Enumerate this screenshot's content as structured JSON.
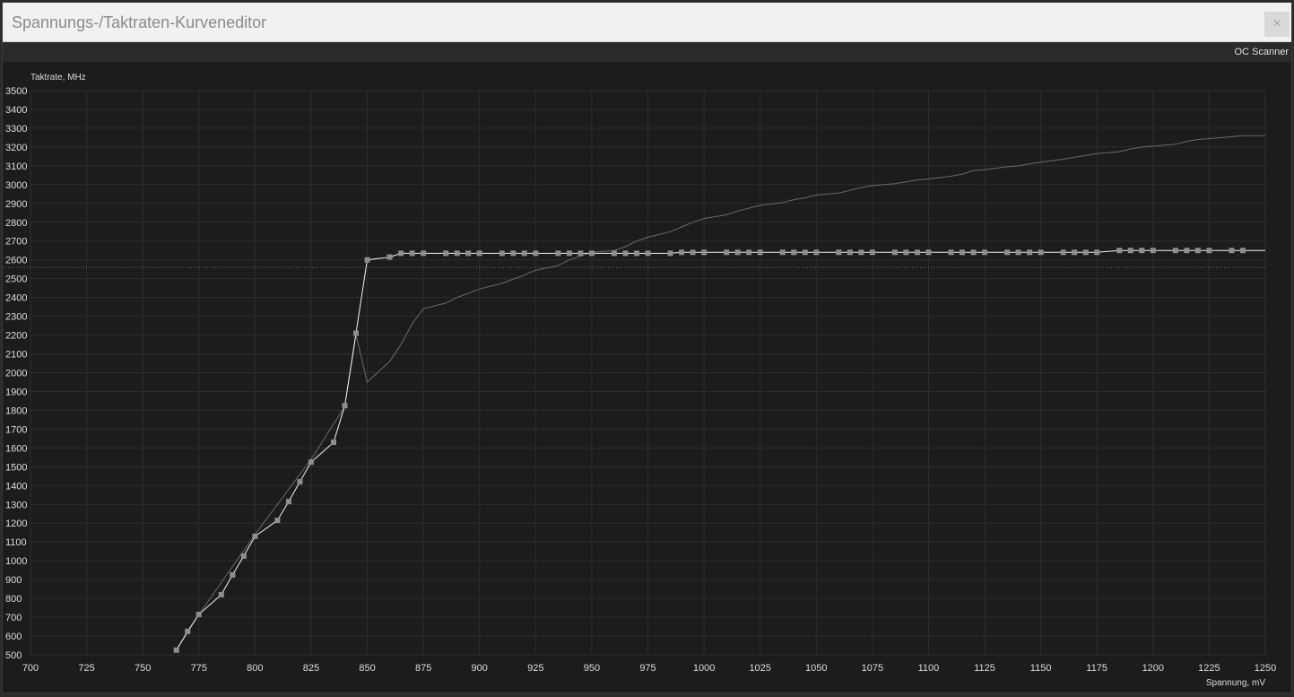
{
  "window": {
    "title": "Spannungs-/Taktraten-Kurveneditor",
    "close_symbol": "×"
  },
  "toolbar": {
    "oc_scanner_label": "OC Scanner"
  },
  "chart_data": {
    "type": "line",
    "title": "",
    "ylabel": "Taktrate, MHz",
    "xlabel": "Spannung, mV",
    "xlim": [
      700,
      1250
    ],
    "ylim": [
      500,
      3500
    ],
    "x_ticks": [
      700,
      725,
      750,
      775,
      800,
      825,
      850,
      875,
      900,
      925,
      950,
      975,
      1000,
      1025,
      1050,
      1075,
      1100,
      1125,
      1150,
      1175,
      1200,
      1225,
      1250
    ],
    "y_ticks": [
      500,
      600,
      700,
      800,
      900,
      1000,
      1100,
      1200,
      1300,
      1400,
      1500,
      1600,
      1700,
      1800,
      1900,
      2000,
      2100,
      2200,
      2300,
      2400,
      2500,
      2600,
      2700,
      2800,
      2900,
      3000,
      3100,
      3200,
      3300,
      3400,
      3500
    ],
    "grid": true,
    "reference_line_y": 2560,
    "colors": {
      "edit_curve": "#f2f2f2",
      "point": "#8e8e8e",
      "default_curve": "#6a6a6a",
      "grid": "#2e2e31",
      "axis_text": "#dcdcdc"
    },
    "series": [
      {
        "points": [
          [
            765,
            525
          ],
          [
            770,
            625
          ],
          [
            775,
            715
          ],
          [
            785,
            820
          ],
          [
            790,
            925
          ],
          [
            795,
            1025
          ],
          [
            800,
            1130
          ],
          [
            810,
            1215
          ],
          [
            815,
            1315
          ],
          [
            820,
            1420
          ],
          [
            825,
            1525
          ],
          [
            835,
            1630
          ],
          [
            840,
            1825
          ],
          [
            845,
            2210
          ],
          [
            850,
            2600
          ],
          [
            860,
            2615
          ],
          [
            865,
            2635
          ],
          [
            870,
            2635
          ],
          [
            875,
            2635
          ],
          [
            885,
            2635
          ],
          [
            890,
            2635
          ],
          [
            895,
            2635
          ],
          [
            900,
            2635
          ],
          [
            910,
            2635
          ],
          [
            915,
            2635
          ],
          [
            920,
            2635
          ],
          [
            925,
            2635
          ],
          [
            935,
            2635
          ],
          [
            940,
            2635
          ],
          [
            945,
            2635
          ],
          [
            950,
            2635
          ],
          [
            960,
            2635
          ],
          [
            965,
            2635
          ],
          [
            970,
            2635
          ],
          [
            975,
            2635
          ],
          [
            985,
            2635
          ],
          [
            990,
            2640
          ],
          [
            995,
            2640
          ],
          [
            1000,
            2640
          ],
          [
            1010,
            2640
          ],
          [
            1015,
            2640
          ],
          [
            1020,
            2640
          ],
          [
            1025,
            2640
          ],
          [
            1035,
            2640
          ],
          [
            1040,
            2640
          ],
          [
            1045,
            2640
          ],
          [
            1050,
            2640
          ],
          [
            1060,
            2640
          ],
          [
            1065,
            2640
          ],
          [
            1070,
            2640
          ],
          [
            1075,
            2640
          ],
          [
            1085,
            2640
          ],
          [
            1090,
            2640
          ],
          [
            1095,
            2640
          ],
          [
            1100,
            2640
          ],
          [
            1110,
            2640
          ],
          [
            1115,
            2640
          ],
          [
            1120,
            2640
          ],
          [
            1125,
            2640
          ],
          [
            1135,
            2640
          ],
          [
            1140,
            2640
          ],
          [
            1145,
            2640
          ],
          [
            1150,
            2640
          ],
          [
            1160,
            2640
          ],
          [
            1165,
            2640
          ],
          [
            1170,
            2640
          ],
          [
            1175,
            2640
          ],
          [
            1185,
            2650
          ],
          [
            1190,
            2650
          ],
          [
            1195,
            2650
          ],
          [
            1200,
            2650
          ],
          [
            1210,
            2650
          ],
          [
            1215,
            2650
          ],
          [
            1220,
            2650
          ],
          [
            1225,
            2650
          ],
          [
            1235,
            2650
          ],
          [
            1240,
            2650
          ],
          [
            1250,
            2650
          ]
        ]
      },
      {
        "points": [
          [
            765,
            525
          ],
          [
            775,
            715
          ],
          [
            800,
            1140
          ],
          [
            825,
            1540
          ],
          [
            840,
            1820
          ],
          [
            845,
            2200
          ],
          [
            850,
            1950
          ],
          [
            860,
            2060
          ],
          [
            865,
            2150
          ],
          [
            870,
            2260
          ],
          [
            875,
            2340
          ],
          [
            885,
            2370
          ],
          [
            890,
            2400
          ],
          [
            900,
            2445
          ],
          [
            910,
            2475
          ],
          [
            920,
            2520
          ],
          [
            925,
            2545
          ],
          [
            935,
            2570
          ],
          [
            940,
            2600
          ],
          [
            945,
            2620
          ],
          [
            950,
            2640
          ],
          [
            960,
            2650
          ],
          [
            965,
            2670
          ],
          [
            970,
            2700
          ],
          [
            975,
            2720
          ],
          [
            985,
            2750
          ],
          [
            990,
            2775
          ],
          [
            995,
            2800
          ],
          [
            1000,
            2820
          ],
          [
            1010,
            2840
          ],
          [
            1015,
            2860
          ],
          [
            1025,
            2890
          ],
          [
            1035,
            2905
          ],
          [
            1040,
            2920
          ],
          [
            1045,
            2930
          ],
          [
            1050,
            2945
          ],
          [
            1060,
            2955
          ],
          [
            1065,
            2970
          ],
          [
            1070,
            2985
          ],
          [
            1075,
            2995
          ],
          [
            1085,
            3005
          ],
          [
            1090,
            3015
          ],
          [
            1095,
            3025
          ],
          [
            1100,
            3030
          ],
          [
            1110,
            3045
          ],
          [
            1115,
            3055
          ],
          [
            1120,
            3075
          ],
          [
            1125,
            3080
          ],
          [
            1135,
            3095
          ],
          [
            1140,
            3100
          ],
          [
            1145,
            3110
          ],
          [
            1150,
            3120
          ],
          [
            1160,
            3135
          ],
          [
            1165,
            3145
          ],
          [
            1170,
            3155
          ],
          [
            1175,
            3165
          ],
          [
            1185,
            3175
          ],
          [
            1190,
            3190
          ],
          [
            1195,
            3200
          ],
          [
            1200,
            3205
          ],
          [
            1210,
            3215
          ],
          [
            1215,
            3230
          ],
          [
            1220,
            3240
          ],
          [
            1225,
            3245
          ],
          [
            1235,
            3255
          ],
          [
            1240,
            3260
          ],
          [
            1250,
            3260
          ]
        ]
      }
    ]
  }
}
